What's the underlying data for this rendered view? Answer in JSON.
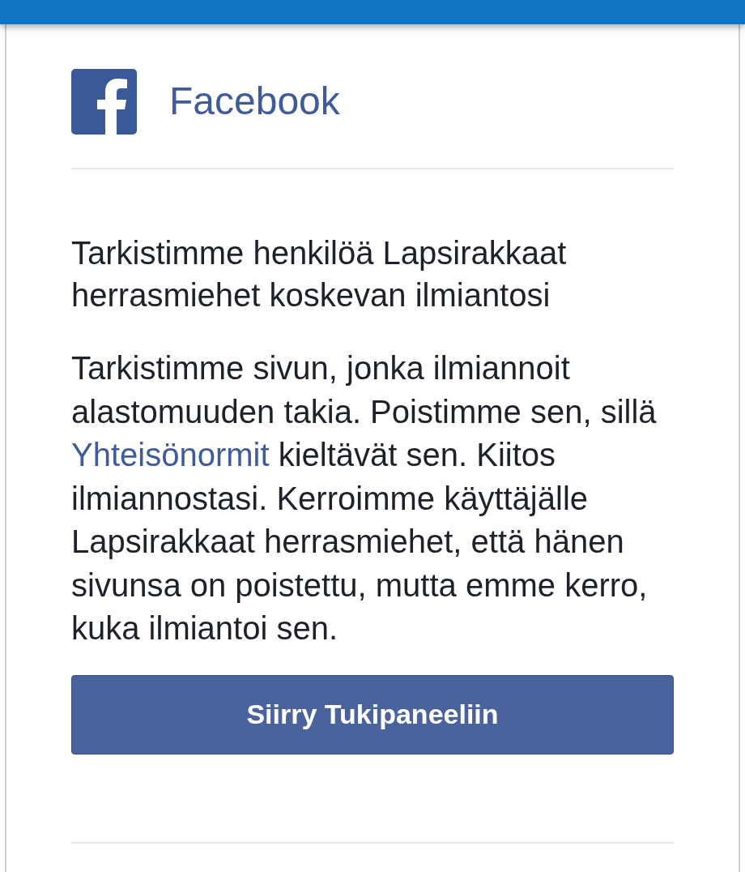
{
  "header": {
    "title": "Facebook"
  },
  "heading": "Tarkistimme henkilöä Lapsirakkaat herrasmiehet koskevan ilmiantosi",
  "message": {
    "before": "Tarkistimme sivun, jonka ilmiannoit alastomuuden takia. Poistimme sen, sillä",
    "link": "Yhteisönormit",
    "after": "kieltävät sen. Kiitos ilmiannostasi. Kerroimme käyttäjälle Lapsirakkaat herrasmiehet, että hänen sivunsa on poistettu, mutta emme kerro, kuka ilmiantoi sen."
  },
  "button": "Siirry Tukipaneeliin"
}
